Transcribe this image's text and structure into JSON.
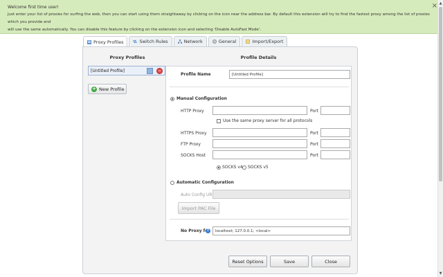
{
  "notice": {
    "title": "Welcome first time user!",
    "line1": "Just enter your list of proxies for surfing the web, then you can start using them straightaway by clicking on the icon near the address bar. By default this extension will try to find the fastest proxy among the list of proxies which you provide and",
    "line2": "will use the same automatically. You can disable this feature by clicking on the extension icon and selecting 'Disable AutoFast Mode'.",
    "close": "×"
  },
  "tabs": [
    {
      "label": "Proxy Profiles",
      "icon": "profiles-icon"
    },
    {
      "label": "Switch Rules",
      "icon": "rules-icon"
    },
    {
      "label": "Network",
      "icon": "network-icon"
    },
    {
      "label": "General",
      "icon": "general-icon"
    },
    {
      "label": "Import/Export",
      "icon": "import-export-icon"
    }
  ],
  "profiles": {
    "header": "Proxy Profiles",
    "items": [
      {
        "name": "[Untitled Profile]",
        "color": "#8fb6e0"
      }
    ],
    "new_label": "New Profile"
  },
  "details": {
    "header": "Profile Details",
    "profile_name_label": "Profile Name",
    "profile_name_value": "[Untitled Profile]",
    "manual_label": "Manual Configuration",
    "http_label": "HTTP Proxy",
    "port_label": "Port",
    "same_proxy_label": "Use the same proxy server for all protocols",
    "https_label": "HTTPS Proxy",
    "ftp_label": "FTP Proxy",
    "socks_label": "SOCKS Host",
    "socks_v4": "SOCKS v4",
    "socks_v5": "SOCKS v5",
    "auto_label": "Automatic Configuration",
    "auto_url_label": "Auto Config URL",
    "import_pac": "Import PAC File",
    "no_proxy_label": "No Proxy for",
    "no_proxy_value": "localhost; 127.0.0.1; <local>"
  },
  "footer": {
    "reset": "Reset Options",
    "save": "Save",
    "close": "Close"
  }
}
